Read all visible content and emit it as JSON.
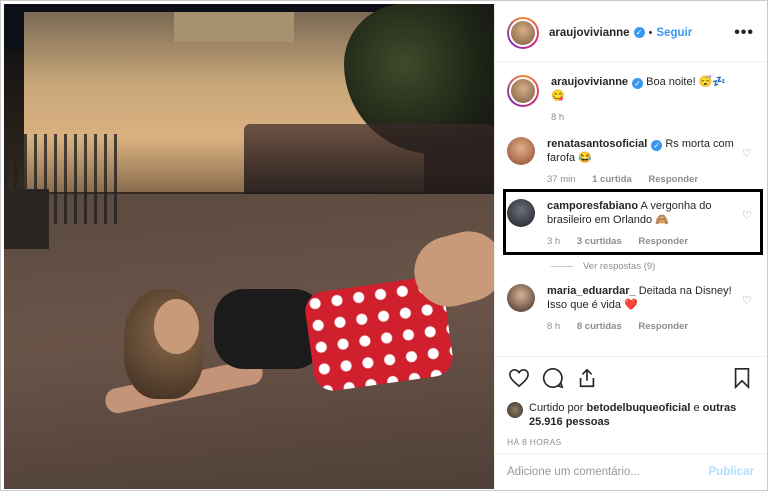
{
  "post": {
    "author": "araujovivianne",
    "follow_label": "Seguir",
    "more_label": "•••",
    "caption": "Boa noite! 😴💤😋",
    "caption_time": "8 h"
  },
  "comments": [
    {
      "user": "renatasantosoficial",
      "text": "Rs morta com farofa 😂",
      "time": "37 min",
      "likes": "1 curtida",
      "reply": "Responder"
    },
    {
      "user": "camporesfabiano",
      "text": "A vergonha do brasileiro em Orlando 🙈",
      "time": "3 h",
      "likes": "3 curtidas",
      "reply": "Responder"
    },
    {
      "user": "maria_eduardar_",
      "text": "Deitada na Disney! Isso que é vida ❤️",
      "time": "8 h",
      "likes": "8 curtidas",
      "reply": "Responder"
    }
  ],
  "view_replies": "Ver respostas (9)",
  "likes": {
    "prefix": "Curtido por",
    "user": "betodelbuqueoficial",
    "connector": "e",
    "others": "outras 25.916 pessoas"
  },
  "post_time": "HÁ 8 HORAS",
  "comment_box": {
    "placeholder": "Adicione um comentário...",
    "publish": "Publicar"
  },
  "icons": [
    "heart-icon",
    "comment-icon",
    "share-icon",
    "bookmark-icon",
    "verified-icon",
    "more-icon"
  ],
  "colors": {
    "accent": "#3897f0",
    "highlight": "#000000",
    "like_red": "#ed4956"
  }
}
